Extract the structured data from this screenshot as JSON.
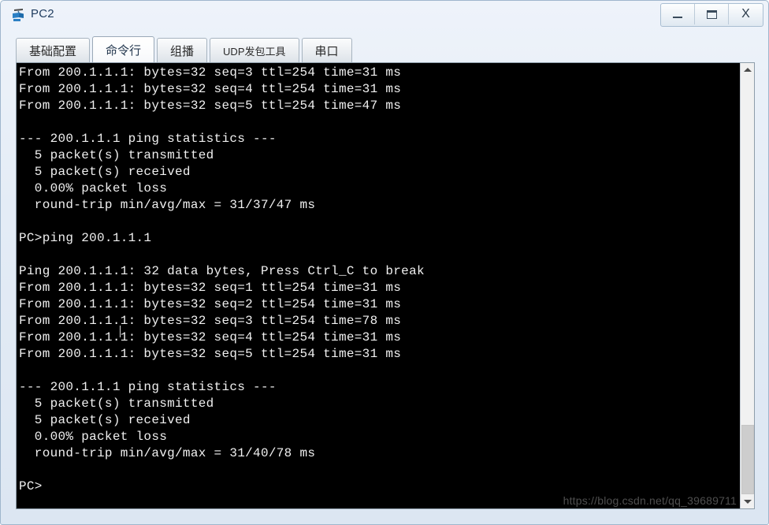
{
  "window": {
    "title": "PC2",
    "icon": "network-device-icon",
    "controls": {
      "minimize_label": "Minimize",
      "maximize_label": "Maximize",
      "close_label": "X"
    }
  },
  "tabs": [
    {
      "label": "基础配置",
      "active": false,
      "name": "tab-basic-config"
    },
    {
      "label": "命令行",
      "active": true,
      "name": "tab-command-line"
    },
    {
      "label": "组播",
      "active": false,
      "name": "tab-multicast"
    },
    {
      "label": "UDP发包工具",
      "active": false,
      "name": "tab-udp-tool"
    },
    {
      "label": "串口",
      "active": false,
      "name": "tab-serial-port"
    }
  ],
  "terminal": {
    "lines": [
      "From 200.1.1.1: bytes=32 seq=3 ttl=254 time=31 ms",
      "From 200.1.1.1: bytes=32 seq=4 ttl=254 time=31 ms",
      "From 200.1.1.1: bytes=32 seq=5 ttl=254 time=47 ms",
      "",
      "--- 200.1.1.1 ping statistics ---",
      "  5 packet(s) transmitted",
      "  5 packet(s) received",
      "  0.00% packet loss",
      "  round-trip min/avg/max = 31/37/47 ms",
      "",
      "PC>ping 200.1.1.1",
      "",
      "Ping 200.1.1.1: 32 data bytes, Press Ctrl_C to break",
      "From 200.1.1.1: bytes=32 seq=1 ttl=254 time=31 ms",
      "From 200.1.1.1: bytes=32 seq=2 ttl=254 time=31 ms",
      "From 200.1.1.1: bytes=32 seq=3 ttl=254 time=78 ms",
      "From 200.1.1.1: bytes=32 seq=4 ttl=254 time=31 ms",
      "From 200.1.1.1: bytes=32 seq=5 ttl=254 time=31 ms",
      "",
      "--- 200.1.1.1 ping statistics ---",
      "  5 packet(s) transmitted",
      "  5 packet(s) received",
      "  0.00% packet loss",
      "  round-trip min/avg/max = 31/40/78 ms",
      "",
      "PC>"
    ],
    "prompt": "PC>",
    "background": "#000000",
    "foreground": "#f0f0f0"
  },
  "watermark": {
    "text": "https://blog.csdn.net/qq_39689711"
  },
  "scrollbar": {
    "up_icon": "chevron-up-icon",
    "down_icon": "chevron-down-icon",
    "position_percent": 100
  }
}
